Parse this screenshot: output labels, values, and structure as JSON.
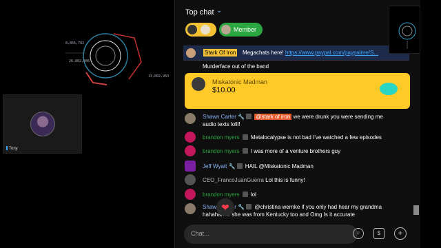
{
  "stream": {
    "hud_numbers": [
      "8,855,702",
      "26,802,086",
      "13,802,963"
    ],
    "cam_name": "Tony"
  },
  "chat": {
    "title": "Top chat",
    "caret_icon": "chevron-down-icon",
    "member_pill": "Member",
    "pinned": {
      "author": "Stark Of Iron",
      "message": "Megachats here!",
      "link": "https://www.paypal.com/paypalme/S..."
    },
    "partial_line": "Murderface out of the band",
    "superchat": {
      "name": "Miskatonic Madman",
      "amount": "$10.00"
    },
    "messages": [
      {
        "author": "Shawn Carter",
        "mention": "@stark of iron",
        "text": "we were drunk you were sending me",
        "text2": "audio texts lolll!",
        "color": "#8ab4f8"
      },
      {
        "author": "brandon myers",
        "text": "Metalocalypse is not bad I've watched a few episodes",
        "color": "#2ba640"
      },
      {
        "author": "brandon myers",
        "text": "I was more of a venture brothers guy",
        "color": "#2ba640"
      },
      {
        "author": "Jeff Wyatt",
        "text": "HAIL @Miskatonic Madman",
        "color": "#8ab4f8"
      },
      {
        "author": "CEO_FrancoJuanGuerra",
        "text": "Lol this is funny!",
        "color": "#bbbbbb"
      },
      {
        "author": "brandon myers",
        "text": "lol",
        "color": "#2ba640"
      },
      {
        "author": "Shawn Carter",
        "text": "@christina wernke if you only had hear my grandma",
        "text2": "hahahaha.. she was from Kentucky too and Omg Is it accurate",
        "color": "#8ab4f8"
      }
    ],
    "input_placeholder": "Chat...",
    "colors": {
      "member_green": "#2ba640",
      "superchat_yellow": "#ffca28",
      "link_blue": "#3ea6ff"
    }
  }
}
